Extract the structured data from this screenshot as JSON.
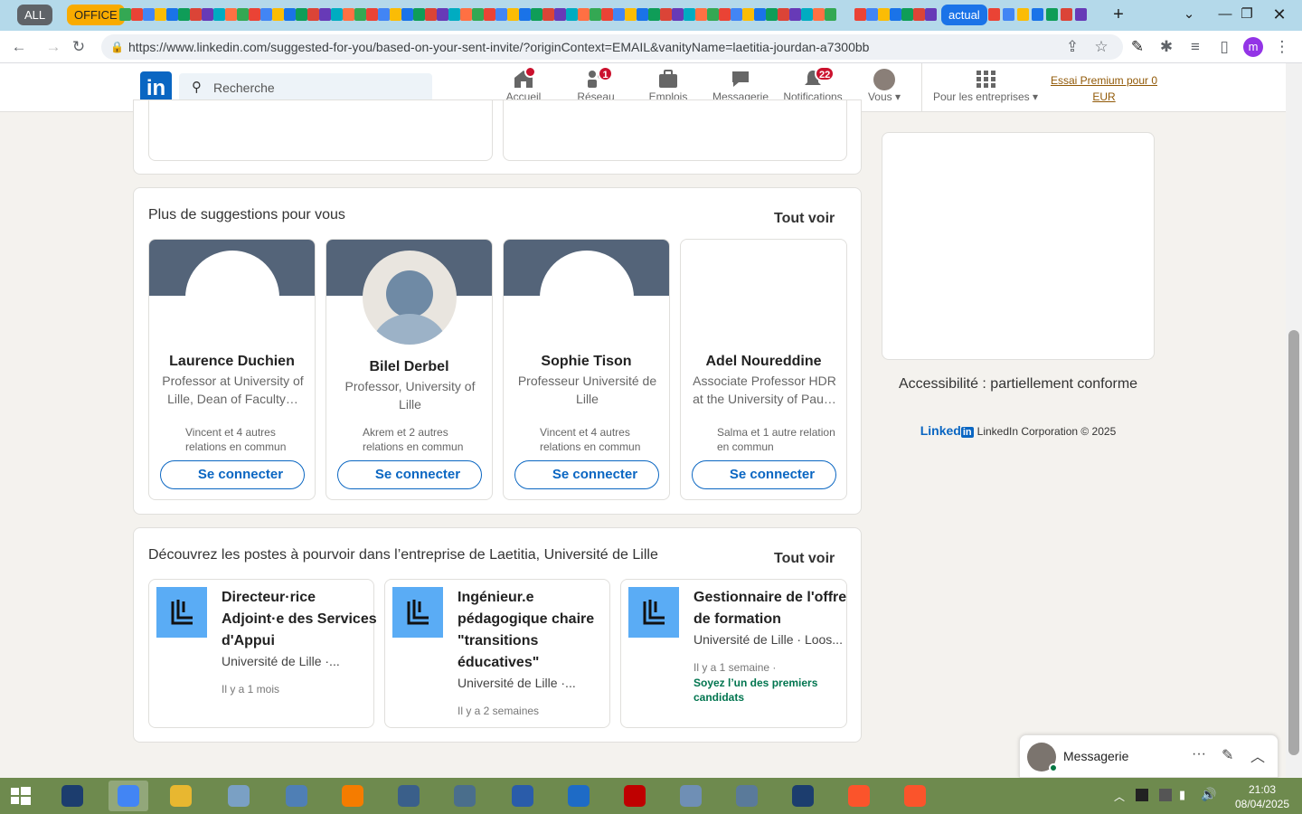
{
  "browser": {
    "tab_groups": [
      {
        "label": "ALL",
        "color": "#5f6368"
      },
      {
        "label": "OFFICE",
        "color": "#f9ab00"
      },
      {
        "label": "actual",
        "color": "#1a73e8"
      }
    ],
    "url": "https://www.linkedin.com/suggested-for-you/based-on-your-sent-invite/?originContext=EMAIL&vanityName=laetitia-jourdan-a7300bb",
    "profile_initial": "m"
  },
  "linkedin_nav": {
    "logo": "in",
    "search_placeholder": "Recherche",
    "items": [
      {
        "label": "Accueil",
        "badge": "",
        "icon": "home-icon"
      },
      {
        "label": "Réseau",
        "badge": "1",
        "icon": "network-icon"
      },
      {
        "label": "Emplois",
        "badge": "",
        "icon": "briefcase-icon"
      },
      {
        "label": "Messagerie",
        "badge": "",
        "icon": "chat-icon"
      },
      {
        "label": "Notifications",
        "badge": "22",
        "icon": "bell-icon"
      },
      {
        "label": "Vous",
        "badge": "",
        "icon": "avatar"
      }
    ],
    "business": "Pour les entreprises",
    "premium": "Essai Premium pour 0 EUR"
  },
  "suggestions": {
    "title": "Plus de suggestions pour vous",
    "see_all": "Tout voir",
    "people": [
      {
        "name": "Laurence Duchien",
        "headline": "Professor at University of Lille, Dean of Faculty…",
        "common": "Vincent et 4 autres relations en commun",
        "button": "Se connecter"
      },
      {
        "name": "Bilel Derbel",
        "headline": "Professor, University of Lille",
        "common": "Akrem et 2 autres relations en commun",
        "button": "Se connecter"
      },
      {
        "name": "Sophie Tison",
        "headline": "Professeur Université de Lille",
        "common": "Vincent et 4 autres relations en commun",
        "button": "Se connecter"
      },
      {
        "name": "Adel Noureddine",
        "headline": "Associate Professor HDR at the University of Pau…",
        "common": "Salma et 1 autre relation en commun",
        "button": "Se connecter"
      }
    ]
  },
  "jobs": {
    "title": "Découvrez les postes à pourvoir dans l’entreprise de Laetitia, Université de Lille",
    "see_all": "Tout voir",
    "items": [
      {
        "title": "Directeur·rice Adjoint·e des Services d'Appui",
        "company": "Université de Lille ·...",
        "time": "Il y a 1 mois",
        "extra": ""
      },
      {
        "title": "Ingénieur.e pédagogique chaire \"transitions éducatives\"",
        "company": "Université de Lille ·...",
        "time": "Il y a 2 semaines",
        "extra": ""
      },
      {
        "title": "Gestionnaire de l'offre de formation",
        "company": "Université de Lille · Loos...",
        "time": "Il y a 1 semaine  ·",
        "extra": "Soyez l’un des premiers candidats"
      }
    ]
  },
  "rail": {
    "accessibility": "Accessibilité : partiellement conforme",
    "footer_logo": "Linked",
    "footer_logo_in": "in",
    "footer": "LinkedIn Corporation © 2025"
  },
  "messaging": {
    "label": "Messagerie"
  },
  "taskbar": {
    "time": "21:03",
    "date": "08/04/2025"
  }
}
